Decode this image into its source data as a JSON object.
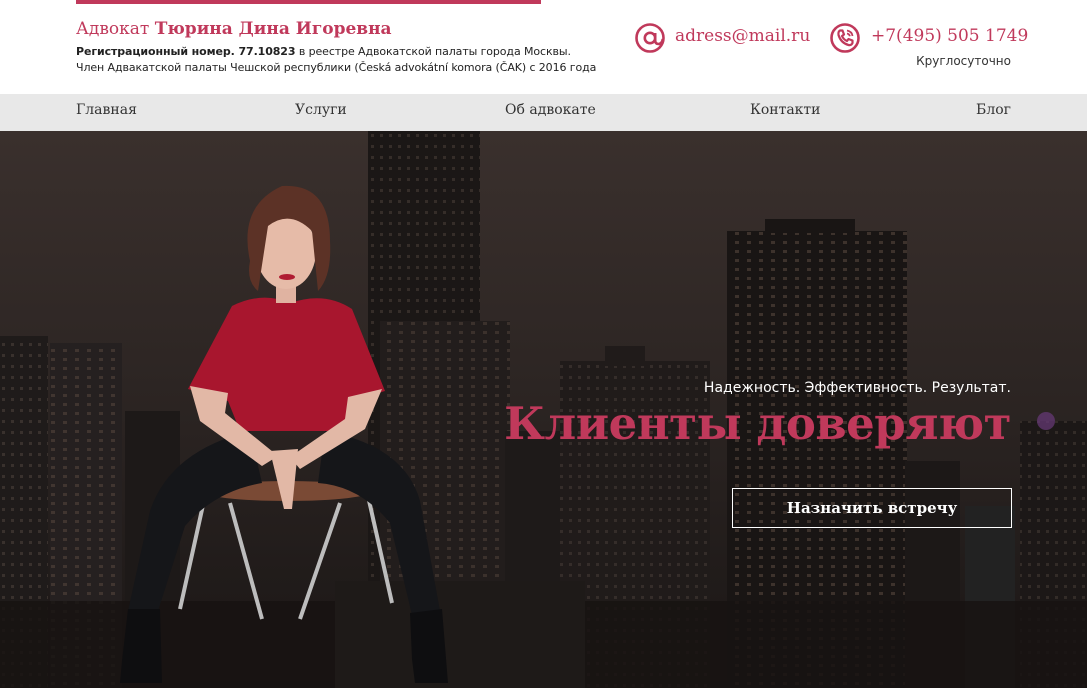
{
  "header": {
    "title_prefix": "Адвокат",
    "title_name": "Тюрина Дина Игоревна",
    "reg_label": "Регистрационный номер. 77.10823",
    "reg_rest": " в реестре Адвокатской палаты города Москвы.",
    "member_line": "Член Адвакатской палаты Чешской республики (Česká advokátní komora (ČAK) с 2016 года",
    "email": "adress@mail.ru",
    "phone": "+7(495) 505 1749",
    "hours": "Круглосуточно",
    "email_icon": "at-sign-icon",
    "phone_icon": "phone-icon"
  },
  "nav": {
    "items": [
      {
        "label": "Главная"
      },
      {
        "label": "Услуги"
      },
      {
        "label": "Об адвокате"
      },
      {
        "label": "Контакти"
      },
      {
        "label": "Блог"
      }
    ]
  },
  "hero": {
    "tagline": "Надежность. Эффективность. Результат.",
    "headline": "Клиенты доверяют",
    "cta_label": "Назначить встречу"
  },
  "colors": {
    "accent": "#c0395b",
    "nav_bg": "#e8e8e8",
    "hero_bg": "#2a2322"
  }
}
